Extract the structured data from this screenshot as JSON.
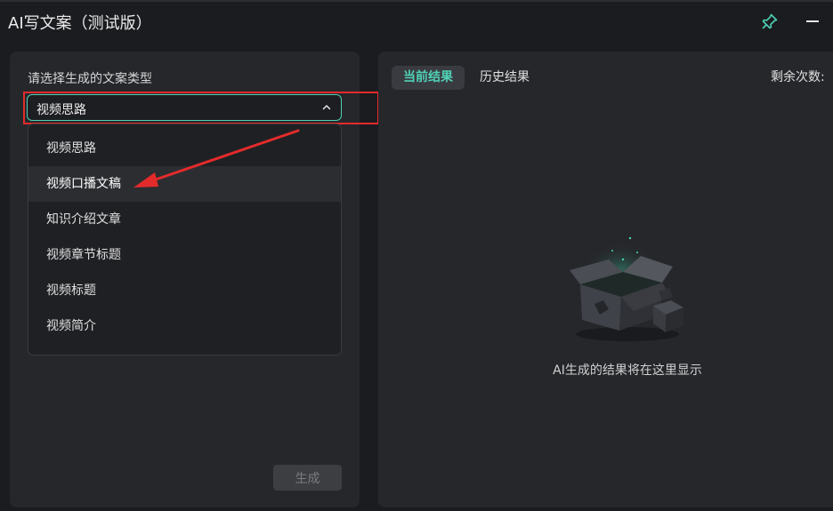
{
  "window": {
    "title": "AI写文案（测试版）",
    "icons": [
      "pin-icon",
      "minimize-icon"
    ]
  },
  "left": {
    "label": "请选择生成的文案类型",
    "select": {
      "value": "视频思路",
      "icon": "chevron-up-icon"
    },
    "options": [
      "视频思路",
      "视频口播文稿",
      "知识介绍文章",
      "视频章节标题",
      "视频标题",
      "视频简介"
    ],
    "hovered_option": "视频口播文稿",
    "generate_label": "生成"
  },
  "right": {
    "tabs": [
      {
        "label": "当前结果",
        "active": true
      },
      {
        "label": "历史结果",
        "active": false
      }
    ],
    "remaining_label": "剩余次数:",
    "empty_message": "AI生成的结果将在这里显示"
  },
  "colors": {
    "accent": "#4fd1b6",
    "highlight": "#e32b2b",
    "panel": "#26272b",
    "background": "#1b1c1f"
  }
}
